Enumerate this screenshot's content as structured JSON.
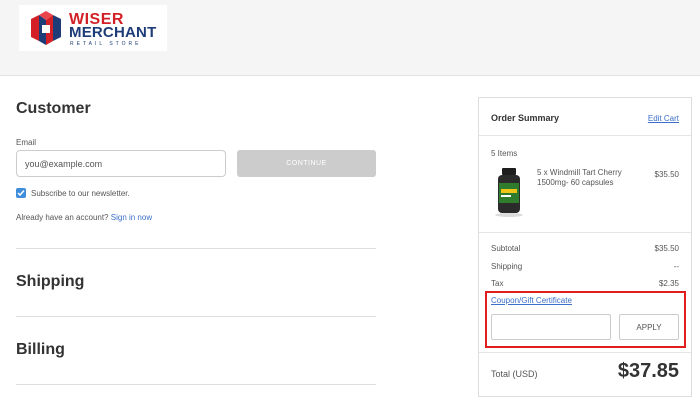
{
  "brand": {
    "line1": "WISER",
    "line2": "MERCHANT",
    "line3": "RETAIL STORE",
    "colors": {
      "red": "#d32027",
      "navy": "#1d3c78"
    }
  },
  "customer": {
    "title": "Customer",
    "email_label": "Email",
    "email_value": "you@example.com",
    "continue_label": "CONTINUE",
    "newsletter_label": "Subscribe to our newsletter.",
    "account_prompt": "Already have an account?",
    "sign_in_label": "Sign in now"
  },
  "shipping": {
    "title": "Shipping"
  },
  "billing": {
    "title": "Billing"
  },
  "summary": {
    "title": "Order Summary",
    "edit_cart": "Edit Cart",
    "items_count": "5 Items",
    "product": {
      "name": "5 x Windmill Tart Cherry 1500mg- 60 capsules",
      "price": "$35.50",
      "icon": "supplement-bottle-icon"
    },
    "rows": [
      {
        "label": "Subtotal",
        "value": "$35.50"
      },
      {
        "label": "Shipping",
        "value": "--"
      },
      {
        "label": "Tax",
        "value": "$2.35"
      }
    ],
    "coupon_link": "Coupon/Gift Certificate",
    "coupon_value": "",
    "apply_label": "APPLY",
    "total_label": "Total (USD)",
    "total_value": "$37.85"
  },
  "colors": {
    "link": "#3b6fc9",
    "checkbox": "#3f8ddb",
    "highlight": "#e01e1e",
    "disabled_button": "#cccccc"
  }
}
